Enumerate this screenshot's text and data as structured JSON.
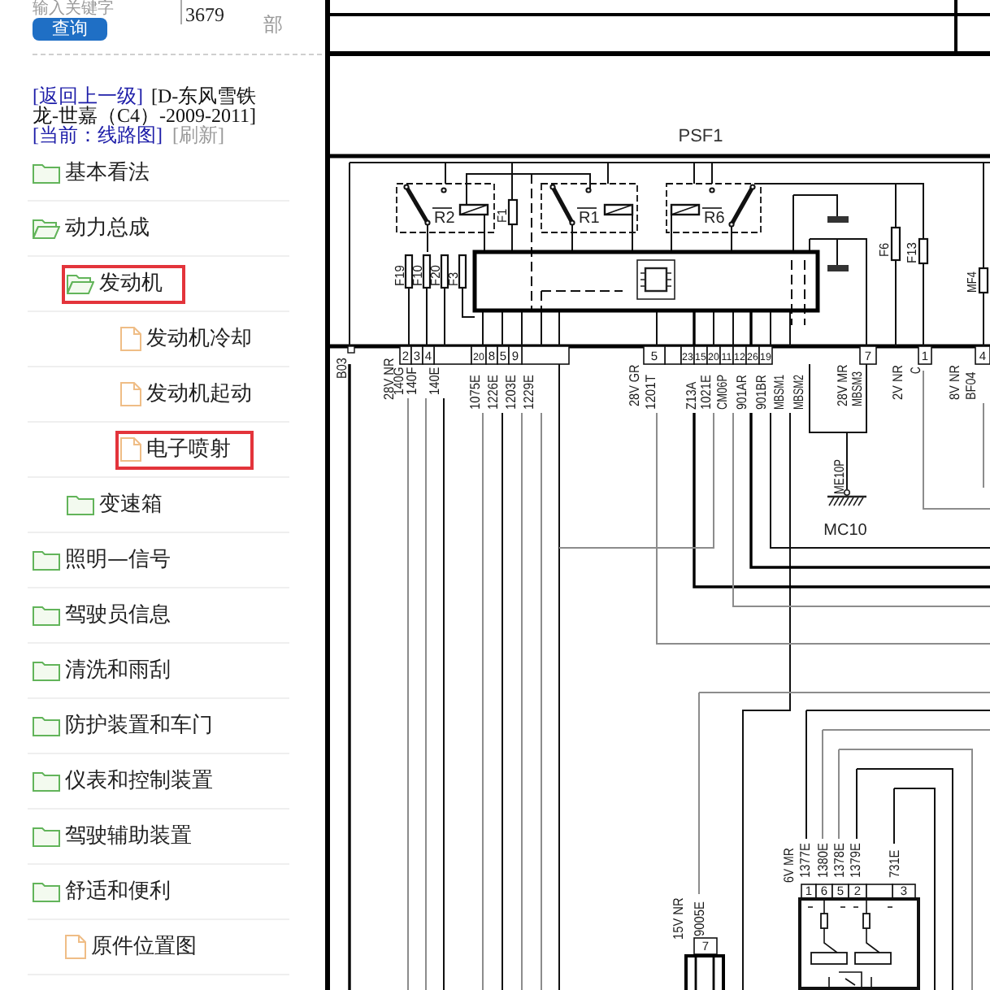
{
  "search": {
    "placeholder": "输入关键字",
    "button": "查询"
  },
  "info_cells": [
    "3679",
    "部"
  ],
  "breadcrumb": {
    "back_link": "[返回上一级]",
    "path": "[D-东风雪铁龙-世嘉（C4）-2009-2011]",
    "current": "[当前：线路图]",
    "refresh": "[刷新]"
  },
  "tree": [
    {
      "label": "基本看法",
      "kind": "folder",
      "expanded": false,
      "highlighted": false
    },
    {
      "label": "动力总成",
      "kind": "folder",
      "expanded": true,
      "highlighted": false,
      "children": [
        {
          "label": "发动机",
          "kind": "folder",
          "expanded": true,
          "highlighted": true,
          "children": [
            {
              "label": "发动机冷却",
              "kind": "file",
              "highlighted": false
            },
            {
              "label": "发动机起动",
              "kind": "file",
              "highlighted": false
            },
            {
              "label": "电子喷射",
              "kind": "file",
              "highlighted": true
            }
          ]
        },
        {
          "label": "变速箱",
          "kind": "folder",
          "expanded": false,
          "highlighted": false
        }
      ]
    },
    {
      "label": "照明—信号",
      "kind": "folder",
      "expanded": false,
      "highlighted": false
    },
    {
      "label": "驾驶员信息",
      "kind": "folder",
      "expanded": false,
      "highlighted": false
    },
    {
      "label": "清洗和雨刮",
      "kind": "folder",
      "expanded": false,
      "highlighted": false
    },
    {
      "label": "防护装置和车门",
      "kind": "folder",
      "expanded": false,
      "highlighted": false
    },
    {
      "label": "仪表和控制装置",
      "kind": "folder",
      "expanded": false,
      "highlighted": false
    },
    {
      "label": "驾驶辅助装置",
      "kind": "folder",
      "expanded": false,
      "highlighted": false
    },
    {
      "label": "舒适和便利",
      "kind": "folder",
      "expanded": false,
      "highlighted": false
    },
    {
      "label": "原件位置图",
      "kind": "file",
      "highlighted": false
    }
  ],
  "diagram": {
    "title": "PSF1",
    "relays": [
      "R2",
      "R1",
      "R6"
    ],
    "fuses": [
      "F1",
      "F19",
      "F10",
      "F20",
      "F3",
      "F6",
      "F13",
      "MF4"
    ],
    "pins": [
      "2",
      "3",
      "4",
      "20",
      "8",
      "5",
      "9",
      "5",
      "23",
      "15",
      "20",
      "11",
      "12",
      "26",
      "19",
      "7",
      "1",
      "4"
    ],
    "wire_labels": [
      "B03",
      "28V NR",
      "140G",
      "140F",
      "140E",
      "1075E",
      "1226E",
      "1203E",
      "1229E",
      "28V GR",
      "1201T",
      "Z13A",
      "1021E",
      "CM06P",
      "901AR",
      "901BR",
      "MBSM1",
      "MBSM2",
      "28V MR",
      "MBSM3",
      "2V NR",
      "C",
      "8V NR",
      "BF04"
    ],
    "ground": {
      "wire_label": "ME10P",
      "label": "MC10"
    },
    "sensor": {
      "wire_labels": [
        "6V MR",
        "1377E",
        "1380E",
        "1378E",
        "1379E",
        "731E"
      ],
      "pins": [
        "1",
        "6",
        "5",
        "2",
        "3"
      ]
    },
    "lower_connector": {
      "wire_labels": [
        "15V NR",
        "9005E"
      ],
      "pins": [
        "7"
      ]
    }
  }
}
